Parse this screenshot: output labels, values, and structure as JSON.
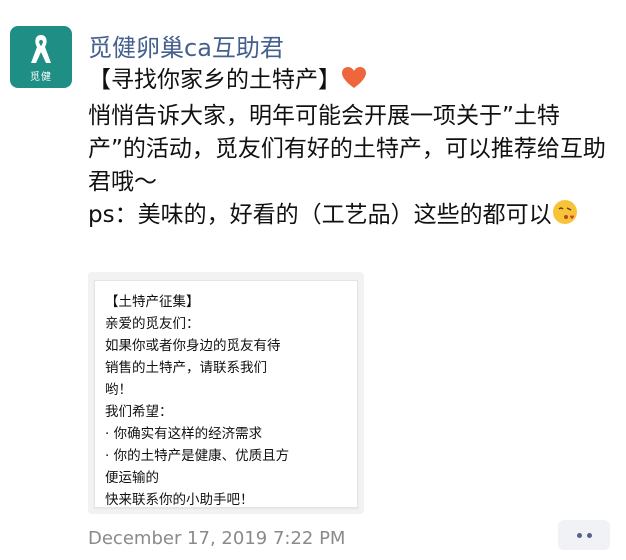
{
  "post": {
    "avatar_text": "觅健",
    "sender": "觅健卵巢ca互助君",
    "title": "【寻找你家乡的土特产】",
    "body_line": "悄悄告诉大家，明年可能会开展一项关于”土特产”的活动，觅友们有好的土特产，可以推荐给互助君哦～",
    "ps_line": "ps：美味的，好看的（工艺品）这些的都可以",
    "heart_icon": "heart-emoji",
    "kiss_icon": "face-blowing-kiss-emoji",
    "timestamp": "December 17, 2019 7:22 PM"
  },
  "image_card": {
    "lines": [
      "【土特产征集】",
      "亲爱的觅友们：",
      "如果你或者你身边的觅友有待",
      "销售的土特产，请联系我们",
      "哟！",
      "我们希望：",
      "· 你确实有这样的经济需求",
      "· 你的土特产是健康、优质且方",
      "便运输的",
      "快来联系你的小助手吧！"
    ]
  },
  "colors": {
    "sender": "#45608f",
    "avatar_bg": "#1f8e84",
    "timestamp": "#8a8a8a",
    "more_button_bg": "#f0f2f6"
  }
}
